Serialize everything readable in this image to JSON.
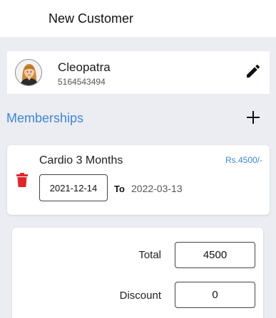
{
  "header": {
    "title": "New Customer"
  },
  "customer": {
    "name": "Cleopatra",
    "phone": "5164543494",
    "avatar_icon": "female-user-avatar-icon"
  },
  "memberships": {
    "title": "Memberships",
    "add_icon": "plus-icon",
    "items": [
      {
        "name": "Cardio 3 Months",
        "price": "Rs.4500/-",
        "start_date": "2021-12-14",
        "to_label": "To",
        "end_date": "2022-03-13",
        "delete_icon": "trash-icon"
      }
    ]
  },
  "totals": {
    "total_label": "Total",
    "total_value": "4500",
    "discount_label": "Discount",
    "discount_value": "0"
  },
  "colors": {
    "accent": "#3d86d6",
    "delete": "#e0262b",
    "background": "#ecedf3"
  }
}
